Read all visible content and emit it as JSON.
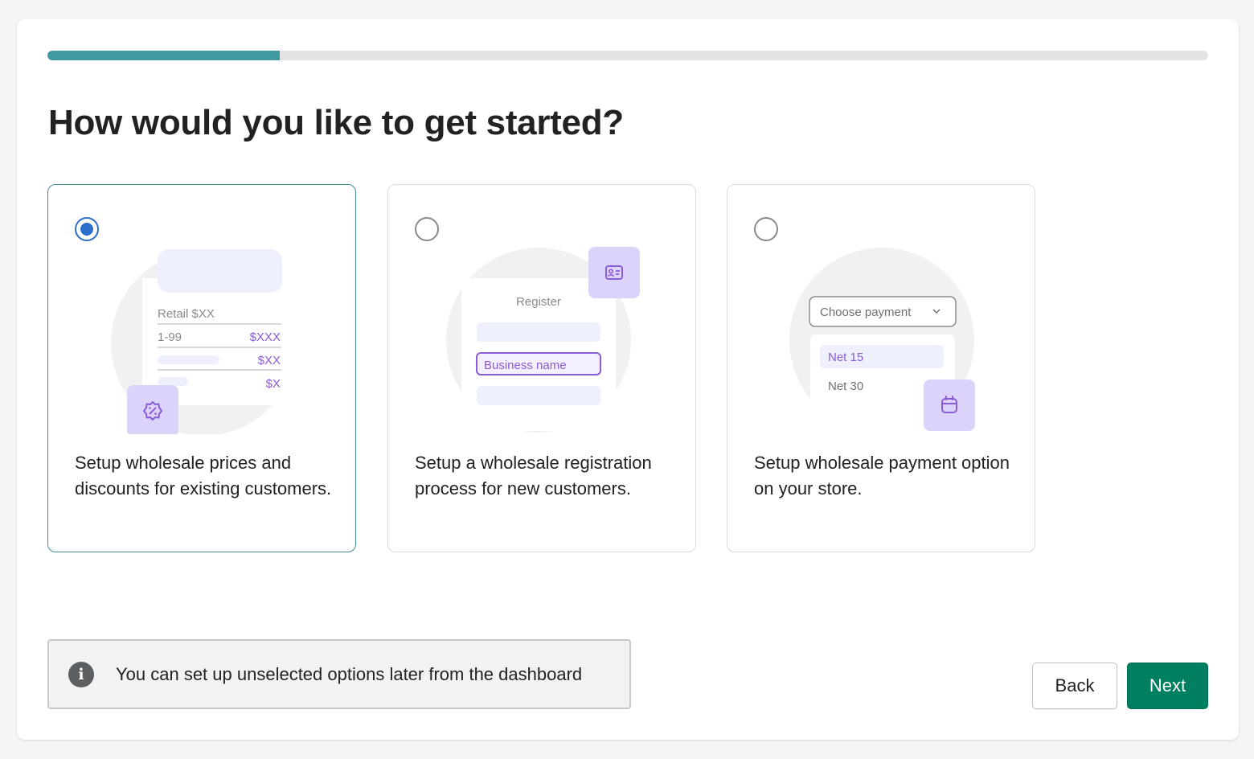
{
  "progress": {
    "fraction": 0.2
  },
  "title": "How would you like to get started?",
  "options": [
    {
      "selected": true,
      "text": "Setup wholesale prices and discounts for existing customers.",
      "illustration": {
        "retail_label": "Retail $XX",
        "range_label": "1-99",
        "price_1": "$XXX",
        "price_2": "$XX",
        "price_3": "$X",
        "icon": "discount-badge-icon"
      }
    },
    {
      "selected": false,
      "text": "Setup a wholesale registration process for new customers.",
      "illustration": {
        "form_title": "Register",
        "field_label": "Business name",
        "icon": "id-card-icon"
      }
    },
    {
      "selected": false,
      "text": "Setup wholesale payment option on your store.",
      "illustration": {
        "select_label": "Choose payment",
        "option_1": "Net 15",
        "option_2": "Net 30",
        "icon": "calendar-icon"
      }
    }
  ],
  "info": {
    "icon": "info-icon",
    "glyph": "i",
    "text": "You can set up unselected options later from the dashboard"
  },
  "buttons": {
    "back": "Back",
    "next": "Next"
  },
  "colors": {
    "accent": "#3f9aa0",
    "radio": "#2c6ecb",
    "primary_button": "#008060",
    "illustration_purple": "#8a5cd8",
    "illustration_lilac": "#dcd3fb"
  }
}
